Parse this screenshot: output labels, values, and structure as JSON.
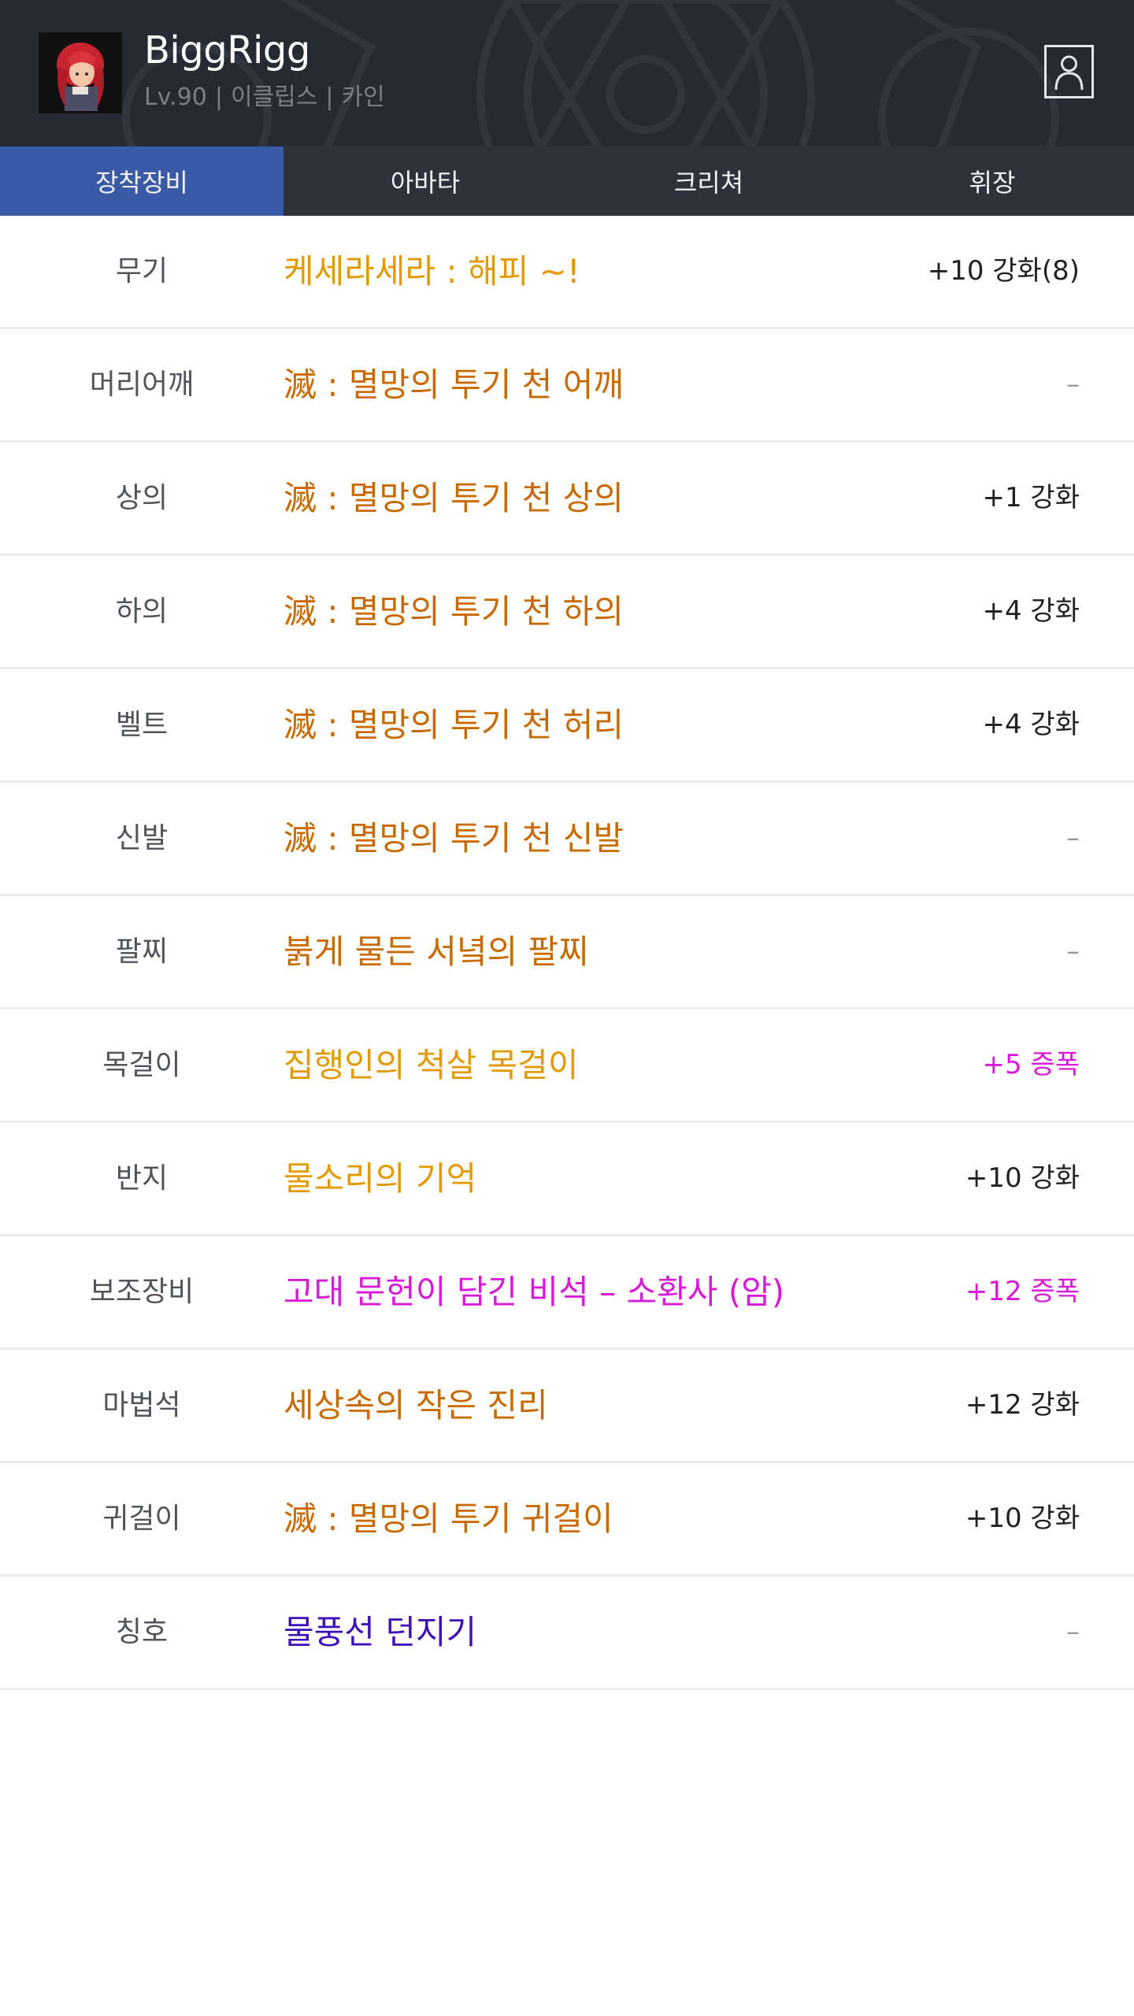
{
  "colors": {
    "header_bg": "#252a33",
    "tab_bar_bg": "#2d323c",
    "tab_active_bg": "#3a5aa6",
    "rarity_epic": "#e39a00",
    "rarity_legendary": "#c86a00",
    "rarity_chronicle": "#d81ad8",
    "rarity_unique": "#3e10b8",
    "value_default": "#222222",
    "value_amplified": "#d81ad8",
    "value_none": "#999999"
  },
  "character": {
    "name": "BiggRigg",
    "level": "Lv.90",
    "class": "이클립스",
    "server": "카인",
    "separator": "|"
  },
  "header": {
    "profile_icon": "person-outline-icon"
  },
  "tabs": [
    {
      "label": "장착장비",
      "active": true
    },
    {
      "label": "아바타",
      "active": false
    },
    {
      "label": "크리쳐",
      "active": false
    },
    {
      "label": "휘장",
      "active": false
    }
  ],
  "equipment": [
    {
      "slot": "무기",
      "item": "케세라세라 : 해피 ~!",
      "item_color": "#e39a00",
      "value": "+10 강화(8)",
      "value_color": "#222222"
    },
    {
      "slot": "머리어깨",
      "item": "滅 : 멸망의 투기 천 어깨",
      "item_color": "#c86a00",
      "value": "–",
      "value_color": "#999999"
    },
    {
      "slot": "상의",
      "item": "滅 : 멸망의 투기 천 상의",
      "item_color": "#c86a00",
      "value": "+1 강화",
      "value_color": "#222222"
    },
    {
      "slot": "하의",
      "item": "滅 : 멸망의 투기 천 하의",
      "item_color": "#c86a00",
      "value": "+4 강화",
      "value_color": "#222222"
    },
    {
      "slot": "벨트",
      "item": "滅 : 멸망의 투기 천 허리",
      "item_color": "#c86a00",
      "value": "+4 강화",
      "value_color": "#222222"
    },
    {
      "slot": "신발",
      "item": "滅 : 멸망의 투기 천 신발",
      "item_color": "#c86a00",
      "value": "–",
      "value_color": "#999999"
    },
    {
      "slot": "팔찌",
      "item": "붉게 물든 서녘의 팔찌",
      "item_color": "#c86a00",
      "value": "–",
      "value_color": "#999999"
    },
    {
      "slot": "목걸이",
      "item": "집행인의 척살 목걸이",
      "item_color": "#e39a00",
      "value": "+5 증폭",
      "value_color": "#d81ad8"
    },
    {
      "slot": "반지",
      "item": "물소리의 기억",
      "item_color": "#e39a00",
      "value": "+10 강화",
      "value_color": "#222222"
    },
    {
      "slot": "보조장비",
      "item": "고대 문헌이 담긴 비석 – 소환사 (암)",
      "item_color": "#d81ad8",
      "value": "+12 증폭",
      "value_color": "#d81ad8"
    },
    {
      "slot": "마법석",
      "item": "세상속의 작은 진리",
      "item_color": "#c86a00",
      "value": "+12 강화",
      "value_color": "#222222"
    },
    {
      "slot": "귀걸이",
      "item": "滅 : 멸망의 투기 귀걸이",
      "item_color": "#c86a00",
      "value": "+10 강화",
      "value_color": "#222222"
    },
    {
      "slot": "칭호",
      "item": "물풍선 던지기",
      "item_color": "#3e10b8",
      "value": "–",
      "value_color": "#999999"
    }
  ]
}
